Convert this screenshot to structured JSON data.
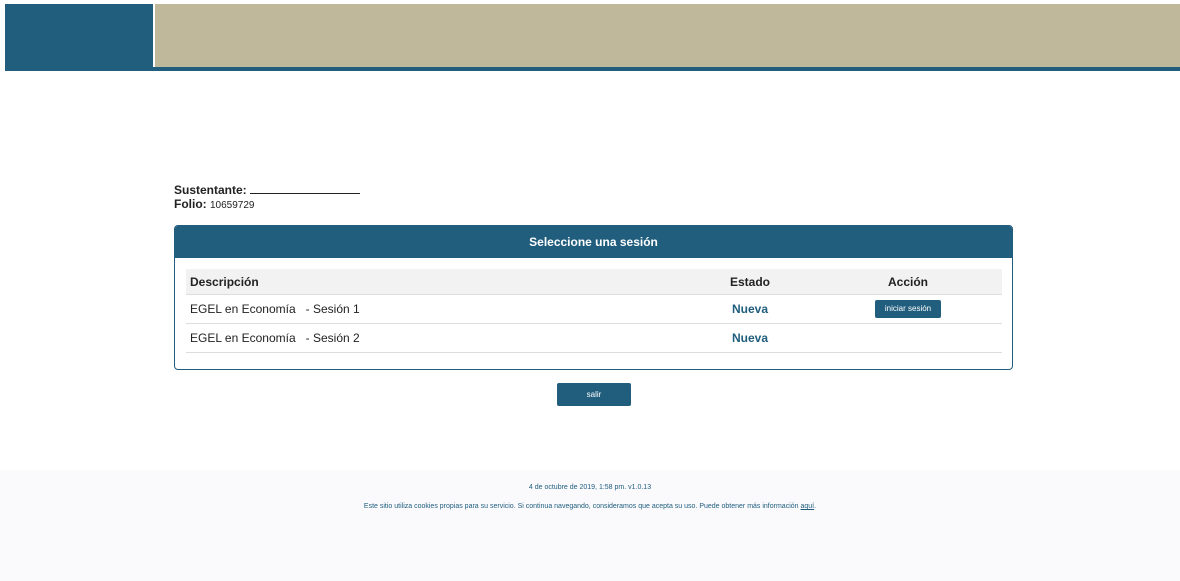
{
  "colors": {
    "brand": "#215e7e",
    "header_bg": "#c0b89b",
    "footer_bg": "#fafafd"
  },
  "info": {
    "sustentante_label": "Sustentante:",
    "folio_label": "Folio:",
    "folio_value": "10659729"
  },
  "panel": {
    "title": "Seleccione una sesión",
    "columns": {
      "descripcion": "Descripción",
      "estado": "Estado",
      "accion": "Acción"
    },
    "rows": [
      {
        "exam": "EGEL en Economía",
        "session": "- Sesión 1",
        "estado": "Nueva",
        "action": "iniciar sesión"
      },
      {
        "exam": "EGEL en Economía",
        "session": "- Sesión 2",
        "estado": "Nueva",
        "action": ""
      }
    ]
  },
  "salir_label": "salir",
  "footer": {
    "timestamp": "4 de octubre de 2019, 1:58 pm. v1.0.13",
    "cookies_text": "Este sitio utiliza cookies propias para su servicio. Si continua navegando, consideramos que acepta su uso. Puede obtener más información",
    "link_text": "aquí",
    "link_suffix": "."
  }
}
